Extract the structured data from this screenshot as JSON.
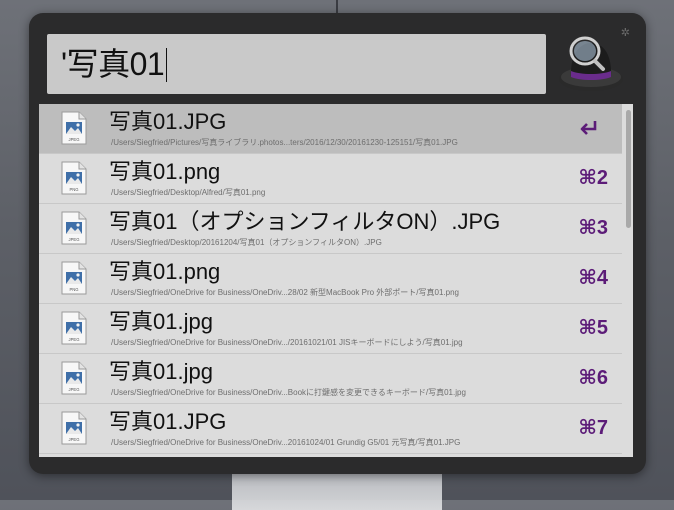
{
  "search": {
    "query": "'写真01"
  },
  "results": [
    {
      "title": "写真01.JPG",
      "path": "/Users/Siegfried/Pictures/写真ライブラリ.photos...ters/2016/12/30/20161230-125151/写真01.JPG",
      "shortcut": "",
      "ext": "JPEG",
      "selected": true
    },
    {
      "title": "写真01.png",
      "path": "/Users/Siegfried/Desktop/Alfred/写真01.png",
      "shortcut": "⌘2",
      "ext": "PNG"
    },
    {
      "title": "写真01（オプションフィルタON）.JPG",
      "path": "/Users/Siegfried/Desktop/20161204/写真01（オプションフィルタON）.JPG",
      "shortcut": "⌘3",
      "ext": "JPEG"
    },
    {
      "title": "写真01.png",
      "path": "/Users/Siegfried/OneDrive for Business/OneDriv...28/02 新型MacBook Pro 外部ポート/写真01.png",
      "shortcut": "⌘4",
      "ext": "PNG"
    },
    {
      "title": "写真01.jpg",
      "path": "/Users/Siegfried/OneDrive for Business/OneDriv.../20161021/01 JISキーボードにしよう/写真01.jpg",
      "shortcut": "⌘5",
      "ext": "JPEG"
    },
    {
      "title": "写真01.jpg",
      "path": "/Users/Siegfried/OneDrive for Business/OneDriv...Bookに打鍵感を変更できるキーボード/写真01.jpg",
      "shortcut": "⌘6",
      "ext": "JPEG"
    },
    {
      "title": "写真01.JPG",
      "path": "/Users/Siegfried/OneDrive for Business/OneDriv...20161024/01 Grundig G5/01 元写真/写真01.JPG",
      "shortcut": "⌘7",
      "ext": "JPEG"
    }
  ],
  "icons": {
    "file": "image-file-icon",
    "enter": "return-key-icon",
    "hat": "alfred-hat-icon",
    "gear": "gear-icon"
  },
  "colors": {
    "shortcut": "#5c1c78",
    "selected_row": "#bdbdbd",
    "window": "#2b2b2c"
  }
}
